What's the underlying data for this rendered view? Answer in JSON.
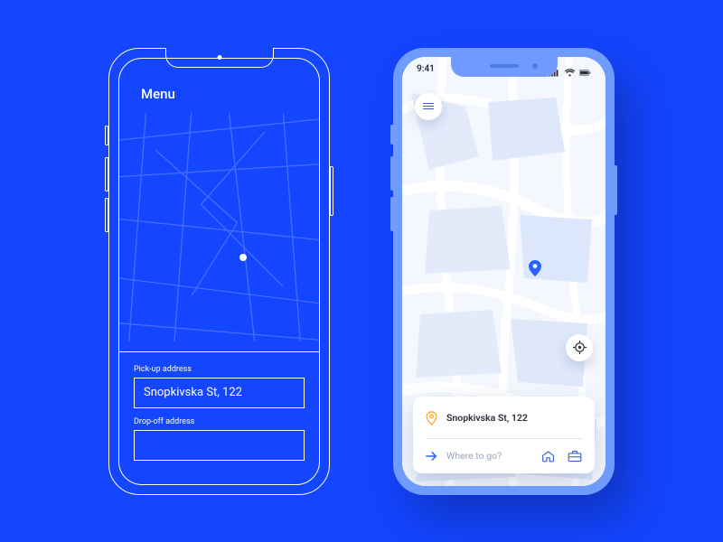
{
  "wireframe": {
    "menu_label": "Menu",
    "pickup_label": "Pick-up address",
    "pickup_value": "Snopkivska St, 122",
    "dropoff_label": "Drop-off address"
  },
  "mock": {
    "status_time": "9:41",
    "pickup_address": "Snopkivska St, 122",
    "destination_placeholder": "Where to go?"
  }
}
